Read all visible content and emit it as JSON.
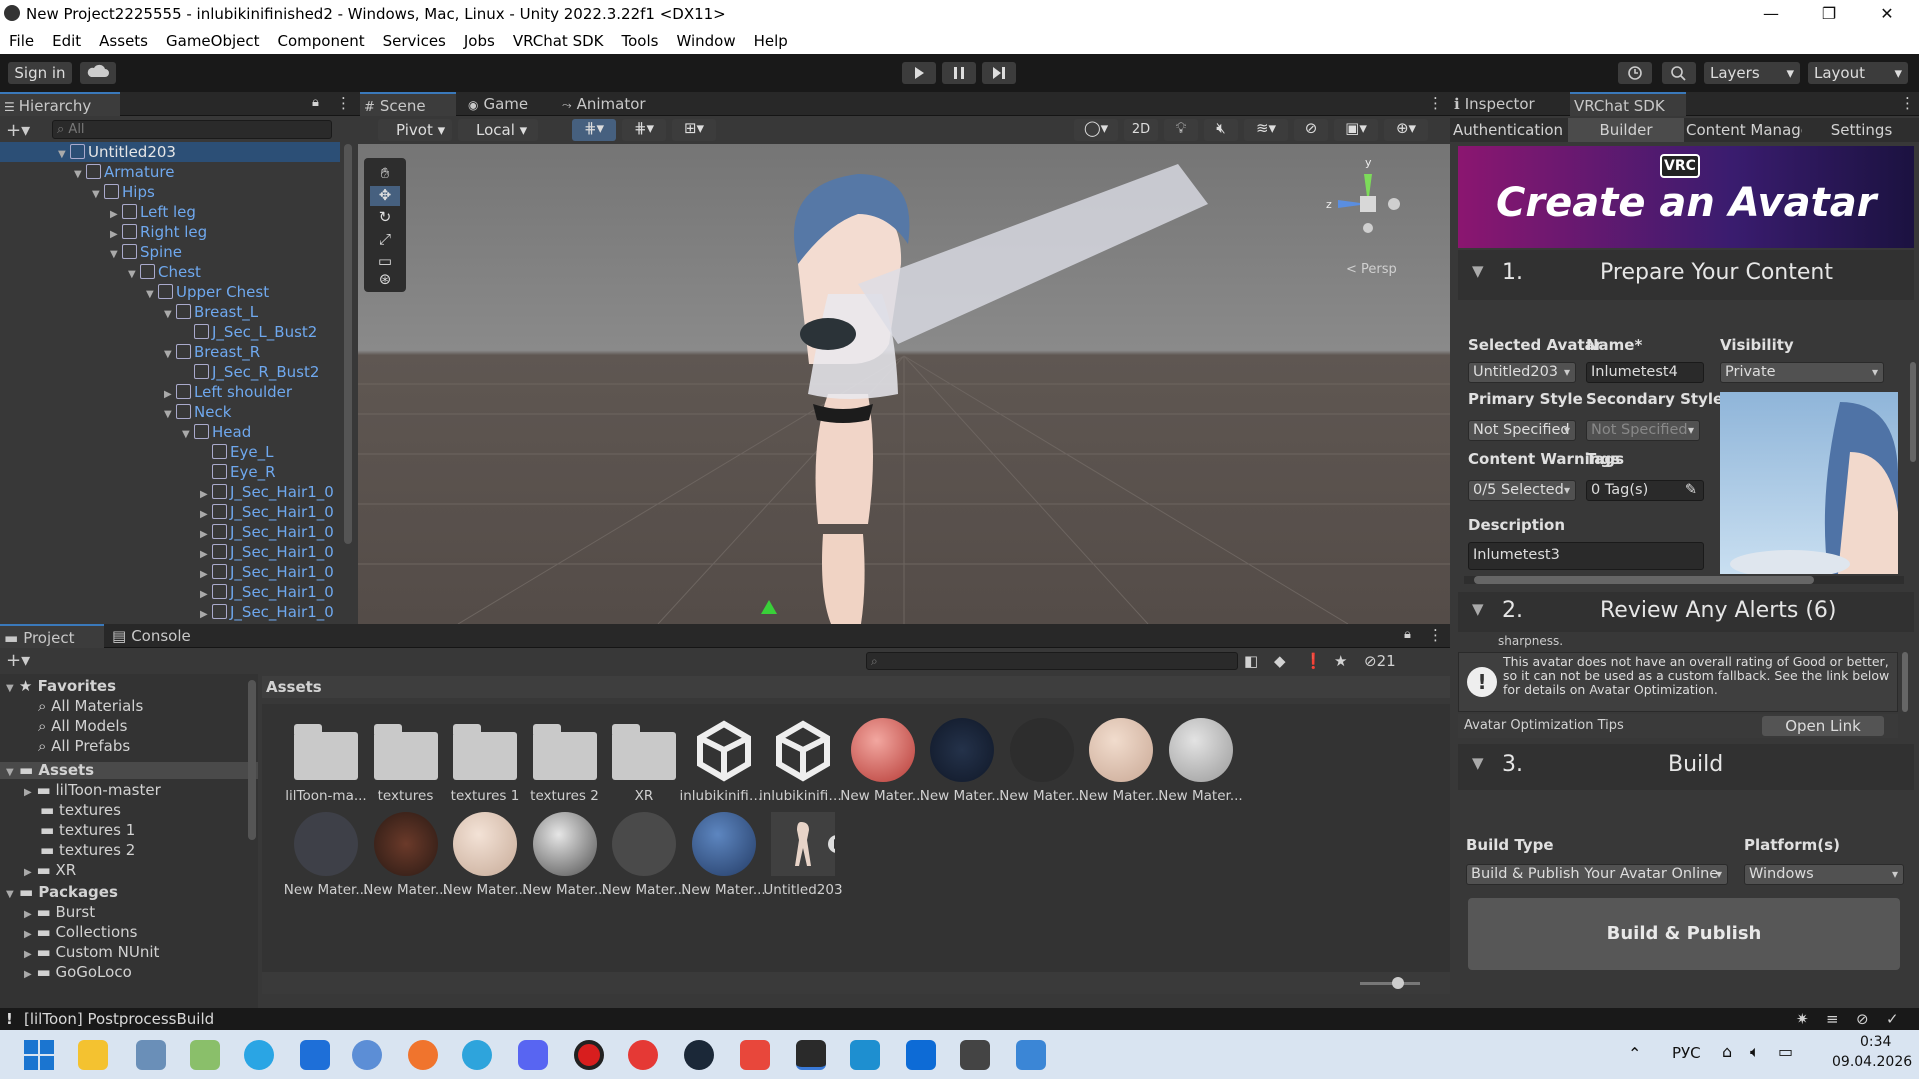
{
  "window": {
    "title": "New Project2225555 - inlubikinifinished2 - Windows, Mac, Linux - Unity 2022.3.22f1 <DX11>",
    "minimize": "—",
    "maximize": "❐",
    "close": "✕"
  },
  "menu": [
    "File",
    "Edit",
    "Assets",
    "GameObject",
    "Component",
    "Services",
    "Jobs",
    "VRChat SDK",
    "Tools",
    "Window",
    "Help"
  ],
  "toolbar": {
    "sign_in": "Sign in",
    "layers": "Layers",
    "layout": "Layout"
  },
  "hierarchy": {
    "tab": "Hierarchy",
    "search_placeholder": "All",
    "items": [
      {
        "label": "Untitled203",
        "depth": 0,
        "open": true,
        "root": true
      },
      {
        "label": "Armature",
        "depth": 1,
        "open": true
      },
      {
        "label": "Hips",
        "depth": 2,
        "open": true
      },
      {
        "label": "Left leg",
        "depth": 3,
        "open": false
      },
      {
        "label": "Right leg",
        "depth": 3,
        "open": false
      },
      {
        "label": "Spine",
        "depth": 3,
        "open": true
      },
      {
        "label": "Chest",
        "depth": 4,
        "open": true
      },
      {
        "label": "Upper Chest",
        "depth": 5,
        "open": true
      },
      {
        "label": "Breast_L",
        "depth": 6,
        "open": true
      },
      {
        "label": "J_Sec_L_Bust2",
        "depth": 7,
        "leaf": true
      },
      {
        "label": "Breast_R",
        "depth": 6,
        "open": true
      },
      {
        "label": "J_Sec_R_Bust2",
        "depth": 7,
        "leaf": true
      },
      {
        "label": "Left shoulder",
        "depth": 6,
        "open": false
      },
      {
        "label": "Neck",
        "depth": 6,
        "open": true
      },
      {
        "label": "Head",
        "depth": 7,
        "open": true
      },
      {
        "label": "Eye_L",
        "depth": 8,
        "leaf": true
      },
      {
        "label": "Eye_R",
        "depth": 8,
        "leaf": true
      },
      {
        "label": "J_Sec_Hair1_0",
        "depth": 8,
        "open": false
      },
      {
        "label": "J_Sec_Hair1_0",
        "depth": 8,
        "open": false
      },
      {
        "label": "J_Sec_Hair1_0",
        "depth": 8,
        "open": false
      },
      {
        "label": "J_Sec_Hair1_0",
        "depth": 8,
        "open": false
      },
      {
        "label": "J_Sec_Hair1_0",
        "depth": 8,
        "open": false
      },
      {
        "label": "J_Sec_Hair1_0",
        "depth": 8,
        "open": false
      },
      {
        "label": "J_Sec_Hair1_0",
        "depth": 8,
        "open": false
      }
    ]
  },
  "scene": {
    "tabs": [
      "Scene",
      "Game",
      "Animator"
    ],
    "pivot": "Pivot",
    "local": "Local",
    "btn_2d": "2D",
    "persp": "< Persp",
    "gizmo_y": "y",
    "gizmo_z": "z"
  },
  "project": {
    "tabs": [
      "Project",
      "Console"
    ],
    "favorites_label": "Favorites",
    "favorites": [
      "All Materials",
      "All Models",
      "All Prefabs"
    ],
    "assets_label": "Assets",
    "asset_folders": [
      "lilToon-master",
      "textures",
      "textures 1",
      "textures 2",
      "XR"
    ],
    "packages_label": "Packages",
    "packages": [
      "Burst",
      "Collections",
      "Custom NUnit",
      "GoGoLoco"
    ],
    "breadcrumb": "Assets",
    "hidden_count": "21",
    "row1": [
      {
        "label": "lilToon-ma...",
        "kind": "folder"
      },
      {
        "label": "textures",
        "kind": "folder"
      },
      {
        "label": "textures 1",
        "kind": "folder"
      },
      {
        "label": "textures 2",
        "kind": "folder"
      },
      {
        "label": "XR",
        "kind": "folder"
      },
      {
        "label": "inlubikinifini...",
        "kind": "unity"
      },
      {
        "label": "inlubikinifini...",
        "kind": "unity"
      },
      {
        "label": "New Mater...",
        "kind": "mat-red"
      },
      {
        "label": "New Mater...",
        "kind": "mat-dark"
      },
      {
        "label": "New Mater...",
        "kind": "mat-black"
      },
      {
        "label": "New Mater...",
        "kind": "mat-skin"
      },
      {
        "label": "New Mater...",
        "kind": "mat-gray"
      }
    ],
    "row2": [
      {
        "label": "New Mater...",
        "kind": "mat-lines"
      },
      {
        "label": "New Mater...",
        "kind": "mat-brown"
      },
      {
        "label": "New Mater...",
        "kind": "mat-face"
      },
      {
        "label": "New Mater...",
        "kind": "mat-shirt"
      },
      {
        "label": "New Mater...",
        "kind": "mat-plain"
      },
      {
        "label": "New Mater...",
        "kind": "mat-blue"
      },
      {
        "label": "Untitled203",
        "kind": "prefab"
      }
    ]
  },
  "inspector": {
    "tabs": [
      "Inspector",
      "VRChat SDK"
    ],
    "sdk_tabs": [
      "Authentication",
      "Builder",
      "Content Manage",
      "Settings"
    ],
    "banner_badge": "VRC",
    "banner_title": "Create an Avatar",
    "sec1_num": "1.",
    "sec1_title": "Prepare Your Content",
    "selected_avatar_label": "Selected Avatar",
    "selected_avatar_value": "Untitled203",
    "name_label": "Name*",
    "name_value": "Inlumetest4",
    "visibility_label": "Visibility",
    "visibility_value": "Private",
    "primary_style_label": "Primary Style",
    "primary_style_value": "Not Specified",
    "secondary_style_label": "Secondary Style",
    "secondary_style_value": "Not Specified",
    "content_warnings_label": "Content Warnings",
    "content_warnings_value": "0/5 Selected",
    "tags_label": "Tags",
    "tags_value": "0 Tag(s)",
    "description_label": "Description",
    "description_value": "Inlumetest3",
    "sec2_num": "2.",
    "sec2_title": "Review Any Alerts (6)",
    "alert_cut": "sharpness.",
    "alert_text": "This avatar does not have an overall rating of Good or better, so it can not be used as a custom fallback. See the link below for details on Avatar Optimization.",
    "tips_label": "Avatar Optimization Tips",
    "open_link": "Open Link",
    "sec3_num": "3.",
    "sec3_title": "Build",
    "build_type_label": "Build Type",
    "build_type_value": "Build & Publish Your Avatar Online",
    "platforms_label": "Platform(s)",
    "platforms_value": "Windows",
    "build_publish": "Build & Publish"
  },
  "status": {
    "message": "[lilToon] PostprocessBuild"
  },
  "taskbar": {
    "lang": "РУС",
    "time": "0:34",
    "date": "09.04.2026"
  }
}
